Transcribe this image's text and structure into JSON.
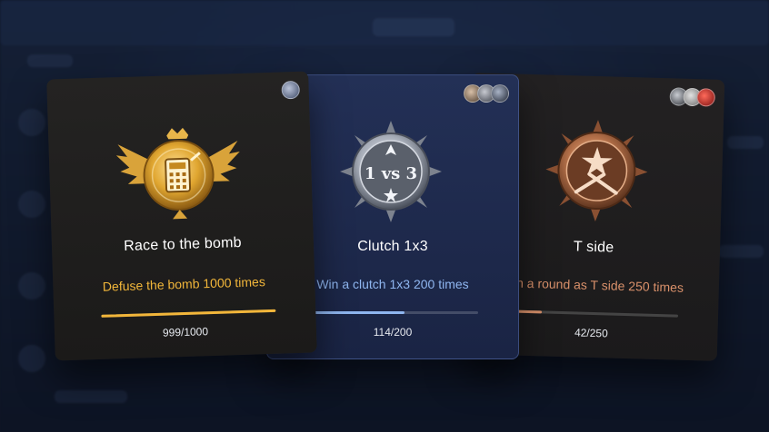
{
  "cards": [
    {
      "id": "bomb",
      "title": "Race to the bomb",
      "description": "Defuse the bomb 1000 times",
      "progress_text": "999/1000",
      "progress": 0.999,
      "medal": "gold-calculator-medal-icon",
      "accent": "#f2b63a"
    },
    {
      "id": "clutch",
      "title": "Clutch 1x3",
      "description": "Win a clutch 1x3 200 times",
      "progress_text": "114/200",
      "progress": 0.57,
      "medal": "silver-clutch-1vs3-medal-icon",
      "medal_text": "1 vs 3",
      "accent": "#8fb6f0"
    },
    {
      "id": "tside",
      "title": "T side",
      "description": "Win a round as T side 250 times",
      "progress_text": "42/250",
      "progress": 0.168,
      "medal": "bronze-t-side-star-medal-icon",
      "accent": "#d8906a"
    }
  ],
  "colors": {
    "gold": "#f2b63a",
    "blue": "#8fb6f0",
    "bronze": "#d8906a"
  }
}
